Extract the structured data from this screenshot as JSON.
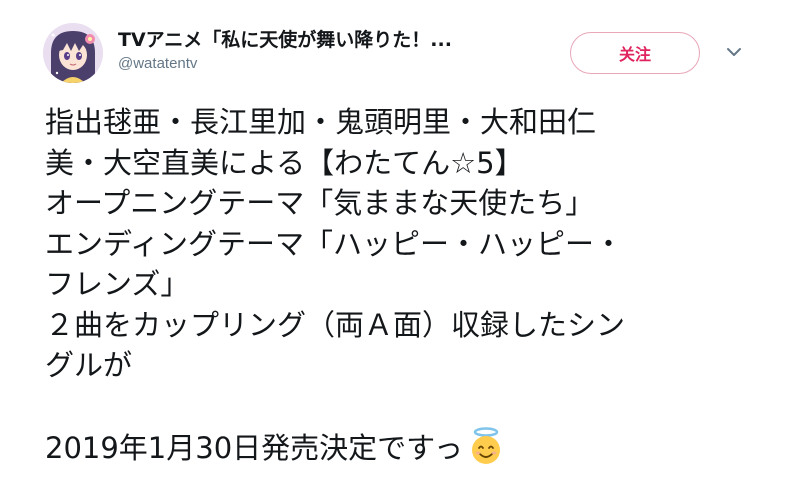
{
  "user": {
    "display_name": "TVアニメ「私に天使が舞い降りた！...",
    "handle": "@watatentv",
    "avatar_icon": "anime-girl-avatar"
  },
  "actions": {
    "follow_label": "关注",
    "menu_icon": "chevron-down-icon"
  },
  "tweet": {
    "lines": [
      "指出毬亜・長江里加・鬼頭明里・大和田仁",
      "美・大空直美による【わたてん☆5】",
      "オープニングテーマ「気ままな天使たち」",
      "エンディングテーマ「ハッピー・ハッピー・",
      "フレンズ」",
      "２曲をカップリング（両Ａ面）収録したシン",
      "グルが",
      "",
      "2019年1月30日発売決定ですっ"
    ],
    "emoji_icon": "angel-face-emoji"
  },
  "colors": {
    "follow_accent": "#e0245e",
    "follow_border": "#e8a6b8",
    "handle_gray": "#657786"
  }
}
